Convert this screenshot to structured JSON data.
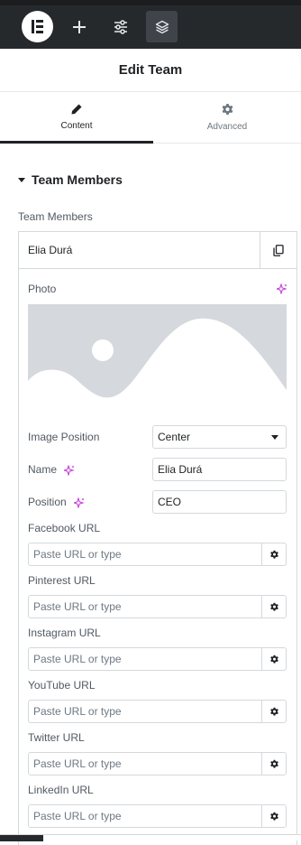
{
  "header": {
    "title": "Edit Team"
  },
  "toolbar": {
    "icons": [
      "elementor-logo-icon",
      "plus-icon",
      "sliders-icon",
      "layers-icon"
    ]
  },
  "tabs": [
    {
      "label": "Content",
      "icon": "pencil-icon",
      "active": true
    },
    {
      "label": "Advanced",
      "icon": "gear-icon",
      "active": false
    }
  ],
  "section": {
    "title": "Team Members"
  },
  "repeater": {
    "label": "Team Members",
    "item_title": "Elia Durá",
    "photo_label": "Photo",
    "image_position": {
      "label": "Image Position",
      "value": "Center"
    },
    "name": {
      "label": "Name",
      "value": "Elia Durá"
    },
    "position": {
      "label": "Position",
      "value": "CEO"
    },
    "urls": [
      {
        "label": "Facebook URL",
        "placeholder": "Paste URL or type"
      },
      {
        "label": "Pinterest URL",
        "placeholder": "Paste URL or type"
      },
      {
        "label": "Instagram URL",
        "placeholder": "Paste URL or type"
      },
      {
        "label": "YouTube URL",
        "placeholder": "Paste URL or type"
      },
      {
        "label": "Twitter URL",
        "placeholder": "Paste URL or type"
      },
      {
        "label": "LinkedIn URL",
        "placeholder": "Paste URL or type"
      }
    ]
  },
  "colors": {
    "toolbar_bg": "#26292c",
    "ai_accent": "#c036d5",
    "border": "#d5d8dc",
    "placeholder_image": "#d5d8dc"
  }
}
